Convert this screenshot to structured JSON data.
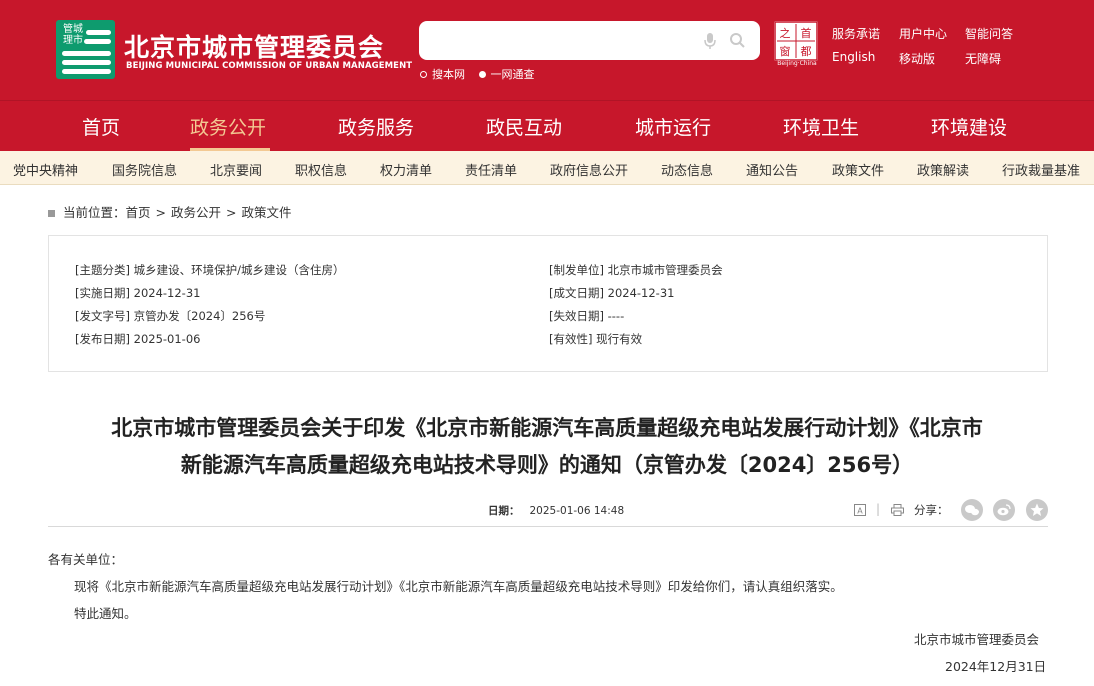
{
  "header": {
    "logo_text": "管城理市",
    "site_title": "北京市城市管理委员会",
    "site_subtitle": "BEIJING MUNICIPAL COMMISSION OF URBAN MANAGEMENT",
    "search_placeholder": "",
    "search_scopes": [
      "搜本网",
      "一网通查"
    ],
    "seal_text": "之首都",
    "seal_caption": "Beijing·China",
    "top_links": [
      "服务承诺",
      "用户中心",
      "智能问答",
      "English",
      "移动版",
      "无障碍"
    ],
    "brand_color": "#c7172b"
  },
  "main_nav": [
    "首页",
    "政务公开",
    "政务服务",
    "政民互动",
    "城市运行",
    "环境卫生",
    "环境建设"
  ],
  "main_nav_active": "政务公开",
  "sub_nav": [
    "党中央精神",
    "国务院信息",
    "北京要闻",
    "职权信息",
    "权力清单",
    "责任清单",
    "政府信息公开",
    "动态信息",
    "通知公告",
    "政策文件",
    "政策解读",
    "行政裁量基准"
  ],
  "breadcrumb": {
    "label": "当前位置：",
    "items": [
      "首页",
      "政务公开",
      "政策文件"
    ]
  },
  "meta": {
    "theme": "[主题分类] 城乡建设、环境保护/城乡建设（含住房）",
    "issuer": "[制发单位] 北京市城市管理委员会",
    "impl_date": "[实施日期] 2024-12-31",
    "write_date": "[成文日期] 2024-12-31",
    "doc_no": "[发文字号] 京管办发〔2024〕256号",
    "expire_date": "[失效日期] ----",
    "pub_date": "[发布日期] 2025-01-06",
    "validity": "[有效性] 现行有效"
  },
  "article": {
    "title_line1": "北京市城市管理委员会关于印发《北京市新能源汽车高质量超级充电站发展行动计划》《北京市",
    "title_line2": "新能源汽车高质量超级充电站技术导则》的通知（京管办发〔2024〕256号）",
    "date_label": "日期：",
    "date_value": "2025-01-06 14:48",
    "share_label": "分享：",
    "salutation": "各有关单位：",
    "paragraph1": "现将《北京市新能源汽车高质量超级充电站发展行动计划》《北京市新能源汽车高质量超级充电站技术导则》印发给你们，请认真组织落实。",
    "paragraph2": "特此通知。",
    "signature": "北京市城市管理委员会",
    "sign_date": "2024年12月31日"
  },
  "icons": [
    "mic-icon",
    "search-icon",
    "font-size-icon",
    "print-icon",
    "wechat-icon",
    "weibo-icon",
    "favorite-icon"
  ]
}
